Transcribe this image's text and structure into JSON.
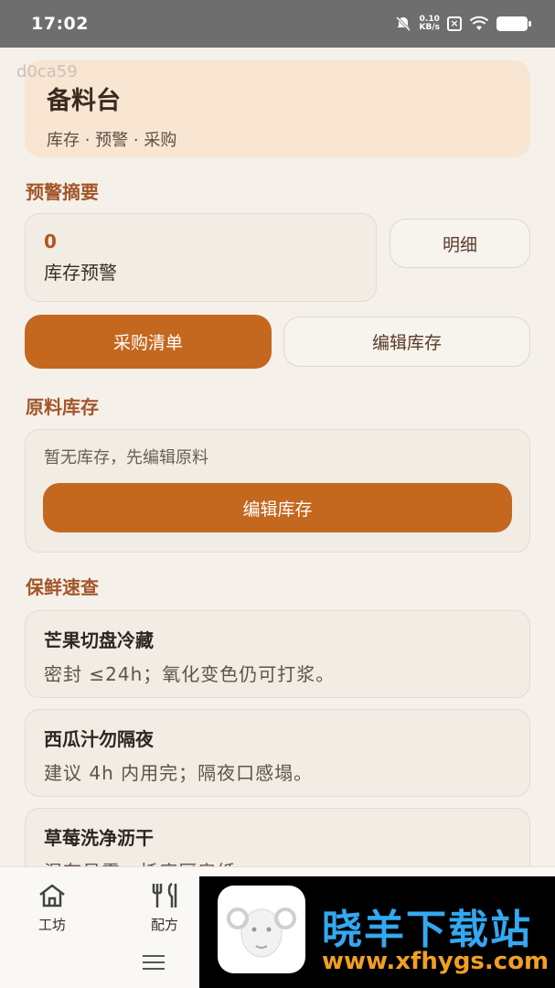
{
  "status": {
    "time": "17:02",
    "net_speed": "0.10",
    "net_unit": "KB/s"
  },
  "watermark_id": "d0ca59",
  "hero": {
    "title": "备料台",
    "subtitle": "库存 · 预警 · 采购"
  },
  "alerts": {
    "section_title": "预警摘要",
    "count": "0",
    "label": "库存预警",
    "detail_button": "明细"
  },
  "actions": {
    "purchase_list": "采购清单",
    "edit_stock": "编辑库存"
  },
  "stock": {
    "section_title": "原料库存",
    "empty_text": "暂无库存，先编辑原料",
    "edit_button": "编辑库存"
  },
  "freshness": {
    "section_title": "保鲜速查",
    "items": [
      {
        "title": "芒果切盘冷藏",
        "desc": "密封 ≤24h；氧化变色仍可打浆。"
      },
      {
        "title": "西瓜汁勿隔夜",
        "desc": "建议 4h 内用完；隔夜口感塌。"
      },
      {
        "title": "草莓洗净沥干",
        "desc": "湿存易霉；托底厨房纸"
      }
    ]
  },
  "bottom_nav": {
    "items": [
      {
        "label": "工坊",
        "icon": "home-icon"
      },
      {
        "label": "配方",
        "icon": "utensils-icon"
      }
    ]
  },
  "promo": {
    "title": "晓羊下载站",
    "url": "www.xfhygs.com"
  },
  "colors": {
    "accent": "#c4671f",
    "section_title": "#a2562a",
    "hero_bg": "#f8e5d2",
    "page_bg": "#f5f1ea"
  }
}
